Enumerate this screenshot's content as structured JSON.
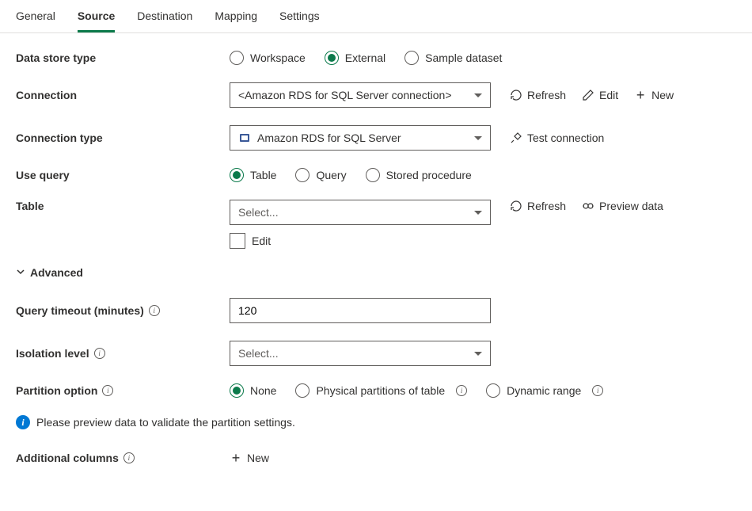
{
  "tabs": [
    "General",
    "Source",
    "Destination",
    "Mapping",
    "Settings"
  ],
  "activeTab": 1,
  "labels": {
    "dataStoreType": "Data store type",
    "connection": "Connection",
    "connectionType": "Connection type",
    "useQuery": "Use query",
    "table": "Table",
    "advanced": "Advanced",
    "queryTimeout": "Query timeout (minutes)",
    "isolationLevel": "Isolation level",
    "partitionOption": "Partition option",
    "additionalColumns": "Additional columns"
  },
  "dataStoreType": {
    "options": [
      "Workspace",
      "External",
      "Sample dataset"
    ],
    "selected": "External"
  },
  "connection": {
    "value": "<Amazon RDS for SQL Server connection>",
    "actions": {
      "refresh": "Refresh",
      "edit": "Edit",
      "new": "New"
    }
  },
  "connectionType": {
    "value": "Amazon RDS for SQL Server",
    "action": "Test connection"
  },
  "useQuery": {
    "options": [
      "Table",
      "Query",
      "Stored procedure"
    ],
    "selected": "Table"
  },
  "table": {
    "placeholder": "Select...",
    "editLabel": "Edit",
    "actions": {
      "refresh": "Refresh",
      "preview": "Preview data"
    }
  },
  "queryTimeout": {
    "value": "120"
  },
  "isolationLevel": {
    "placeholder": "Select..."
  },
  "partitionOption": {
    "options": [
      "None",
      "Physical partitions of table",
      "Dynamic range"
    ],
    "selected": "None"
  },
  "infoMessage": "Please preview data to validate the partition settings.",
  "additionalColumns": {
    "new": "New"
  }
}
